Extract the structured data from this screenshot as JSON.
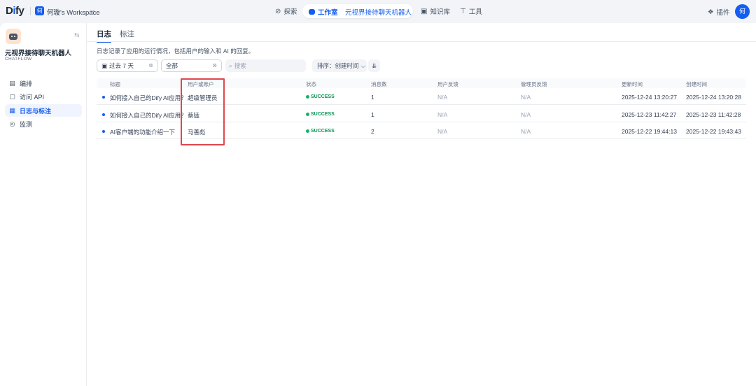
{
  "topbar": {
    "logo_left": "D",
    "logo_i": "i",
    "logo_right": "fy",
    "workspace_avatar": "何",
    "workspace_name": "何璇's Workspace",
    "nav": {
      "explore": "探索",
      "studio": "工作室",
      "current_app": "元视界接待聊天机器人",
      "knowledge": "知识库",
      "tools": "工具"
    },
    "plugins": "插件",
    "user_avatar": "何"
  },
  "sidebar": {
    "app_name": "元视界接待聊天机器人",
    "app_type": "CHATFLOW",
    "items": [
      {
        "label": "编排",
        "icon": "layout-icon"
      },
      {
        "label": "访问 API",
        "icon": "terminal-icon"
      },
      {
        "label": "日志与标注",
        "icon": "file-text-icon",
        "active": true
      },
      {
        "label": "监测",
        "icon": "gauge-icon"
      }
    ]
  },
  "tabs": {
    "logs": "日志",
    "annotations": "标注"
  },
  "description": "日志记录了应用的运行情况，包括用户的输入和 AI 的回复。",
  "filters": {
    "period": "过去 7 天",
    "status": "全部",
    "search_placeholder": "搜索",
    "sort": "排序：创建时间"
  },
  "table": {
    "columns": [
      "标题",
      "用户或账户",
      "状态",
      "消息数",
      "用户反馈",
      "管理员反馈",
      "更新时间",
      "创建时间"
    ],
    "rows": [
      {
        "title": "如何接入自己的Dify AI应用？",
        "user": "超级管理员",
        "status": "SUCCESS",
        "messages": "1",
        "user_feedback": "N/A",
        "admin_feedback": "N/A",
        "updated": "2025-12-24 13:20:27",
        "created": "2025-12-24 13:20:28"
      },
      {
        "title": "如何接入自己的Dify AI应用？",
        "user": "蔡猛",
        "status": "SUCCESS",
        "messages": "1",
        "user_feedback": "N/A",
        "admin_feedback": "N/A",
        "updated": "2025-12-23 11:42:27",
        "created": "2025-12-23 11:42:28"
      },
      {
        "title": "AI客户端的功能介绍一下",
        "user": "马善彪",
        "status": "SUCCESS",
        "messages": "2",
        "user_feedback": "N/A",
        "admin_feedback": "N/A",
        "updated": "2025-12-22 19:44:13",
        "created": "2025-12-22 19:43:43"
      }
    ]
  },
  "colors": {
    "accent": "#155eef",
    "success": "#17b26a",
    "highlight_box": "#e0464e"
  }
}
